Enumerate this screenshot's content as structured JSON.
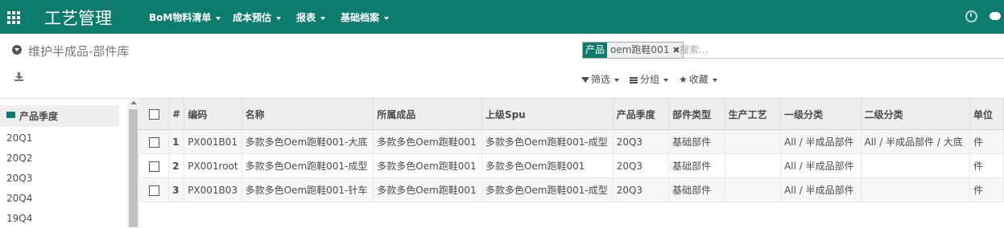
{
  "navbar": {
    "app_title": "工艺管理",
    "menus": [
      "BoM物料清单",
      "成本预估",
      "报表",
      "基础档案"
    ]
  },
  "control": {
    "page_title": "维护半成品-部件库",
    "search": {
      "facet_label": "产品",
      "facet_value": "oem跑鞋001",
      "placeholder": "搜索..."
    },
    "filters_label": "筛选",
    "groupby_label": "分组",
    "favorites_label": "收藏"
  },
  "sidepanel": {
    "title": "产品季度",
    "items": [
      "20Q1",
      "20Q2",
      "20Q3",
      "20Q4",
      "19Q4"
    ]
  },
  "table": {
    "columns": [
      "#",
      "编码",
      "名称",
      "所属成品",
      "上级Spu",
      "产品季度",
      "部件类型",
      "生产工艺",
      "一级分类",
      "二级分类",
      "单位"
    ],
    "rows": [
      [
        "1",
        "PX001B01",
        "多款多色Oem跑鞋001-大底",
        "多款多色Oem跑鞋001",
        "多款多色Oem跑鞋001-成型",
        "20Q3",
        "基础部件",
        "",
        "All / 半成品部件",
        "All / 半成品部件 / 大底",
        "件"
      ],
      [
        "2",
        "PX001root",
        "多款多色Oem跑鞋001-成型",
        "多款多色Oem跑鞋001",
        "多款多色Oem跑鞋001",
        "20Q3",
        "基础部件",
        "",
        "All / 半成品部件",
        "",
        "件"
      ],
      [
        "3",
        "PX001B03",
        "多款多色Oem跑鞋001-针车",
        "多款多色Oem跑鞋001",
        "多款多色Oem跑鞋001-成型",
        "20Q3",
        "基础部件",
        "",
        "All / 半成品部件",
        "",
        "件"
      ]
    ]
  },
  "colors": {
    "brand": "#0d7c6d",
    "header_bg": "#eeeeee"
  }
}
